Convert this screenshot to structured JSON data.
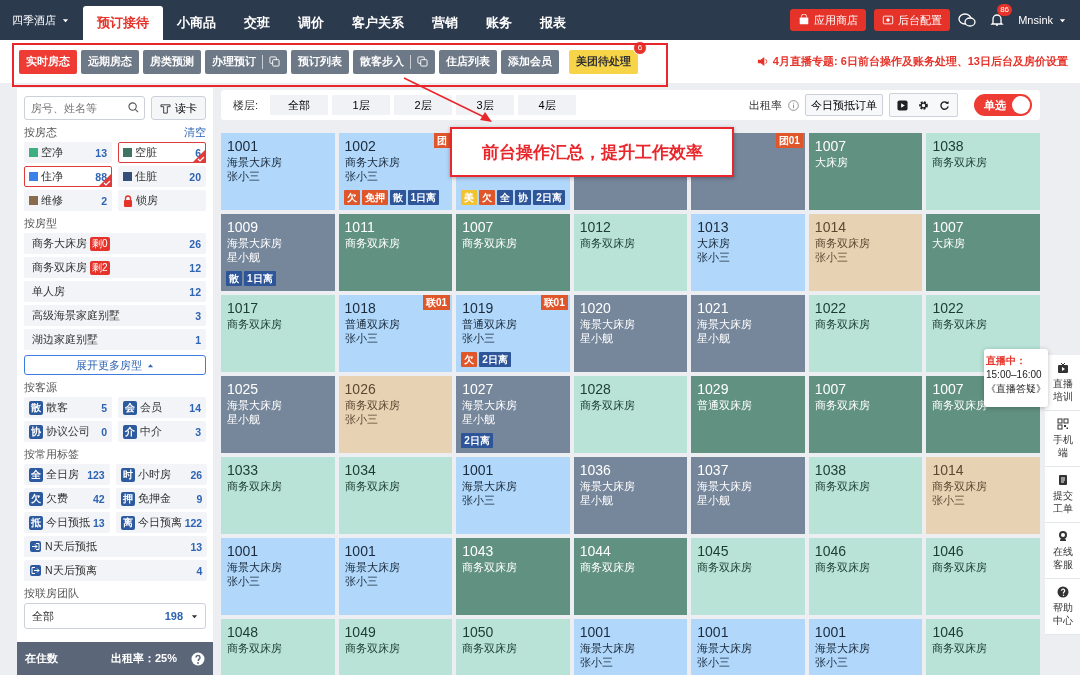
{
  "hotel": {
    "name": "四季酒店"
  },
  "nav": [
    {
      "label": "预订接待",
      "selected": true
    },
    {
      "label": "小商品",
      "selected": false
    },
    {
      "label": "交班",
      "selected": false
    },
    {
      "label": "调价",
      "selected": false
    },
    {
      "label": "客户关系",
      "selected": false
    },
    {
      "label": "营销",
      "selected": false
    },
    {
      "label": "账务",
      "selected": false
    },
    {
      "label": "报表",
      "selected": false
    }
  ],
  "header_buttons": [
    {
      "label": "应用商店"
    },
    {
      "label": "后台配置"
    }
  ],
  "notifications": {
    "count": "86"
  },
  "user": {
    "name": "Mnsink"
  },
  "subtabs": [
    {
      "label": "实时房态",
      "selected": true,
      "kind": "plain"
    },
    {
      "label": "远期房态",
      "selected": false,
      "kind": "plain"
    },
    {
      "label": "房类预测",
      "selected": false,
      "kind": "plain"
    },
    {
      "label": "办理预订",
      "selected": false,
      "kind": "split"
    },
    {
      "label": "预订列表",
      "selected": false,
      "kind": "plain"
    },
    {
      "label": "散客步入",
      "selected": false,
      "kind": "split"
    },
    {
      "label": "住店列表",
      "selected": false,
      "kind": "plain"
    },
    {
      "label": "添加会员",
      "selected": false,
      "kind": "plain"
    },
    {
      "label": "美团待处理",
      "selected": false,
      "kind": "alert",
      "badge": "6"
    }
  ],
  "announcement": "4月直播专题: 6日前台操作及账务处理、13日后台及房价设置",
  "search": {
    "placeholder": "房号、姓名等"
  },
  "read_card": "读卡",
  "room_status": {
    "title": "按房态",
    "clear": "清空",
    "items": [
      {
        "label": "空净",
        "count": "13",
        "color": "#3fae80",
        "checked": false,
        "kind": "swatch"
      },
      {
        "label": "空脏",
        "count": "6",
        "color": "#3e7461",
        "checked": true,
        "kind": "swatch"
      },
      {
        "label": "住净",
        "count": "88",
        "color": "#3b82e8",
        "checked": true,
        "kind": "swatch"
      },
      {
        "label": "住脏",
        "count": "20",
        "color": "#34507a",
        "checked": false,
        "kind": "swatch"
      },
      {
        "label": "维修",
        "count": "2",
        "color": "#8a6a4d",
        "checked": false,
        "kind": "swatch"
      },
      {
        "label": "锁房",
        "checked": false,
        "kind": "lock"
      }
    ]
  },
  "room_types": {
    "title": "按房型",
    "items": [
      {
        "label": "商务大床房",
        "remaining": "剩0",
        "count": "26"
      },
      {
        "label": "商务双床房",
        "remaining": "剩2",
        "count": "12"
      },
      {
        "label": "单人房",
        "count": "12"
      },
      {
        "label": "高级海景家庭别墅",
        "count": "3"
      },
      {
        "label": "湖边家庭别墅",
        "count": "1"
      }
    ],
    "expand": "展开更多房型"
  },
  "sources": {
    "title": "按客源",
    "items": [
      {
        "icon": "散",
        "label": "散客",
        "count": "5"
      },
      {
        "icon": "会",
        "label": "会员",
        "count": "14"
      },
      {
        "icon": "协",
        "label": "协议公司",
        "count": "0"
      },
      {
        "icon": "介",
        "label": "中介",
        "count": "3"
      }
    ]
  },
  "tags": {
    "title": "按常用标签",
    "items": [
      {
        "kind": "half",
        "icon": "全",
        "label": "全日房",
        "count": "123"
      },
      {
        "kind": "half",
        "icon": "时",
        "label": "小时房",
        "count": "26"
      },
      {
        "kind": "half",
        "icon": "欠",
        "label": "欠费",
        "count": "42"
      },
      {
        "kind": "half",
        "icon": "押",
        "label": "免押金",
        "count": "9"
      },
      {
        "kind": "half",
        "icon": "抵",
        "label": "今日预抵",
        "count": "13"
      },
      {
        "kind": "half",
        "icon": "离",
        "label": "今日预离",
        "count": "122"
      },
      {
        "kind": "arrive",
        "label": "N天后预抵",
        "count": "13"
      },
      {
        "kind": "leave",
        "label": "N天后预离",
        "count": "4"
      }
    ]
  },
  "team": {
    "title": "按联房团队",
    "value": "全部",
    "count": "198"
  },
  "status_bar": {
    "occupied": "在住数",
    "rate": "出租率：25%"
  },
  "floors": {
    "label": "楼层:",
    "items": [
      "全部",
      "1层",
      "2层",
      "3层",
      "4层"
    ]
  },
  "toolbar": {
    "rate_label": "出租率",
    "prebook_button": "今日预抵订单",
    "single_select": {
      "label": "单选",
      "on": true
    }
  },
  "rooms": [
    {
      "number": "1001",
      "type": "海景大床房",
      "guest": "张小三",
      "kind": "occupied"
    },
    {
      "number": "1002",
      "type": "商务大床房",
      "guest": "张小三",
      "kind": "occupied",
      "badge": "团",
      "tags": [
        {
          "label": "欠",
          "color": "#e0562b"
        },
        {
          "label": "免押",
          "color": "#e0562b"
        },
        {
          "label": "散",
          "color": "#2d5597"
        },
        {
          "label": "1日离",
          "color": "#2d5597"
        }
      ]
    },
    {
      "kind": "occupied",
      "tags": [
        {
          "label": "美",
          "color": "#f2c230"
        },
        {
          "label": "欠",
          "color": "#e0562b"
        },
        {
          "label": "全",
          "color": "#2d5597"
        },
        {
          "label": "协",
          "color": "#2d5597"
        },
        {
          "label": "2日离",
          "color": "#2d5597"
        }
      ]
    },
    {
      "kind": "messy"
    },
    {
      "kind": "messy",
      "badge": "团01"
    },
    {
      "number": "1007",
      "type": "大床房",
      "kind": "dirty"
    },
    {
      "number": "1038",
      "type": "商务双床房",
      "kind": "clean"
    },
    {
      "number": "1009",
      "type": "海景大床房",
      "guest": "星小舰",
      "kind": "messy",
      "tags": [
        {
          "label": "散",
          "color": "#2d5597"
        },
        {
          "label": "1日离",
          "color": "#2d5597"
        }
      ]
    },
    {
      "number": "1011",
      "type": "商务双床房",
      "kind": "dirty"
    },
    {
      "number": "1007",
      "type": "商务双床房",
      "kind": "dirty"
    },
    {
      "number": "1012",
      "type": "商务双床房",
      "kind": "clean"
    },
    {
      "number": "1013",
      "type": "大床房",
      "guest": "张小三",
      "kind": "occupied"
    },
    {
      "number": "1014",
      "type": "商务双床房",
      "guest": "张小三",
      "kind": "repair"
    },
    {
      "number": "1007",
      "type": "大床房",
      "kind": "dirty"
    },
    {
      "number": "1017",
      "type": "商务双床房",
      "kind": "clean"
    },
    {
      "number": "1018",
      "type": "普通双床房",
      "guest": "张小三",
      "kind": "occupied",
      "badge": "联01"
    },
    {
      "number": "1019",
      "type": "普通双床房",
      "guest": "张小三",
      "kind": "occupied",
      "badge": "联01",
      "tags": [
        {
          "label": "欠",
          "color": "#e0562b"
        },
        {
          "label": "2日离",
          "color": "#2d5597"
        }
      ]
    },
    {
      "number": "1020",
      "type": "海景大床房",
      "guest": "星小舰",
      "kind": "messy"
    },
    {
      "number": "1021",
      "type": "海景大床房",
      "guest": "星小舰",
      "kind": "messy"
    },
    {
      "number": "1022",
      "type": "商务双床房",
      "kind": "clean"
    },
    {
      "number": "1022",
      "type": "商务双床房",
      "kind": "clean"
    },
    {
      "number": "1025",
      "type": "海景大床房",
      "guest": "星小舰",
      "kind": "messy"
    },
    {
      "number": "1026",
      "type": "商务双床房",
      "guest": "张小三",
      "kind": "repair"
    },
    {
      "number": "1027",
      "type": "海景大床房",
      "guest": "星小舰",
      "kind": "messy",
      "tags": [
        {
          "label": "2日离",
          "color": "#2d5597"
        }
      ]
    },
    {
      "number": "1028",
      "type": "商务双床房",
      "kind": "clean"
    },
    {
      "number": "1029",
      "type": "普通双床房",
      "kind": "dirty"
    },
    {
      "number": "1007",
      "type": "商务双床房",
      "kind": "dirty"
    },
    {
      "number": "1007",
      "type": "商务双床房",
      "kind": "dirty"
    },
    {
      "number": "1033",
      "type": "商务双床房",
      "kind": "clean"
    },
    {
      "number": "1034",
      "type": "商务双床房",
      "kind": "clean"
    },
    {
      "number": "1001",
      "type": "海景大床房",
      "guest": "张小三",
      "kind": "occupied"
    },
    {
      "number": "1036",
      "type": "海景大床房",
      "guest": "星小舰",
      "kind": "messy"
    },
    {
      "number": "1037",
      "type": "海景大床房",
      "guest": "星小舰",
      "kind": "messy"
    },
    {
      "number": "1038",
      "type": "商务双床房",
      "kind": "clean"
    },
    {
      "number": "1014",
      "type": "商务双床房",
      "guest": "张小三",
      "kind": "repair"
    },
    {
      "number": "1001",
      "type": "海景大床房",
      "guest": "张小三",
      "kind": "occupied"
    },
    {
      "number": "1001",
      "type": "海景大床房",
      "guest": "张小三",
      "kind": "occupied"
    },
    {
      "number": "1043",
      "type": "商务双床房",
      "kind": "dirty"
    },
    {
      "number": "1044",
      "type": "商务双床房",
      "kind": "dirty"
    },
    {
      "number": "1045",
      "type": "商务双床房",
      "kind": "clean"
    },
    {
      "number": "1046",
      "type": "商务双床房",
      "kind": "clean"
    },
    {
      "number": "1046",
      "type": "商务双床房",
      "kind": "clean"
    },
    {
      "number": "1048",
      "type": "商务双床房",
      "kind": "clean"
    },
    {
      "number": "1049",
      "type": "商务双床房",
      "kind": "clean"
    },
    {
      "number": "1050",
      "type": "商务双床房",
      "kind": "clean"
    },
    {
      "number": "1001",
      "type": "海景大床房",
      "guest": "张小三",
      "kind": "occupied"
    },
    {
      "number": "1001",
      "type": "海景大床房",
      "guest": "张小三",
      "kind": "occupied"
    },
    {
      "number": "1001",
      "type": "海景大床房",
      "guest": "张小三",
      "kind": "occupied"
    },
    {
      "number": "1046",
      "type": "商务双床房",
      "kind": "clean"
    }
  ],
  "annotation": {
    "text": "前台操作汇总，提升工作效率"
  },
  "live_tooltip": {
    "status": "直播中：",
    "time": "15:00–16:00",
    "title": "《直播答疑》"
  },
  "side_tools": [
    {
      "label": "直播培训"
    },
    {
      "label": "手机端"
    },
    {
      "label": "提交工单"
    },
    {
      "label": "在线客服"
    },
    {
      "label": "帮助中心"
    }
  ]
}
